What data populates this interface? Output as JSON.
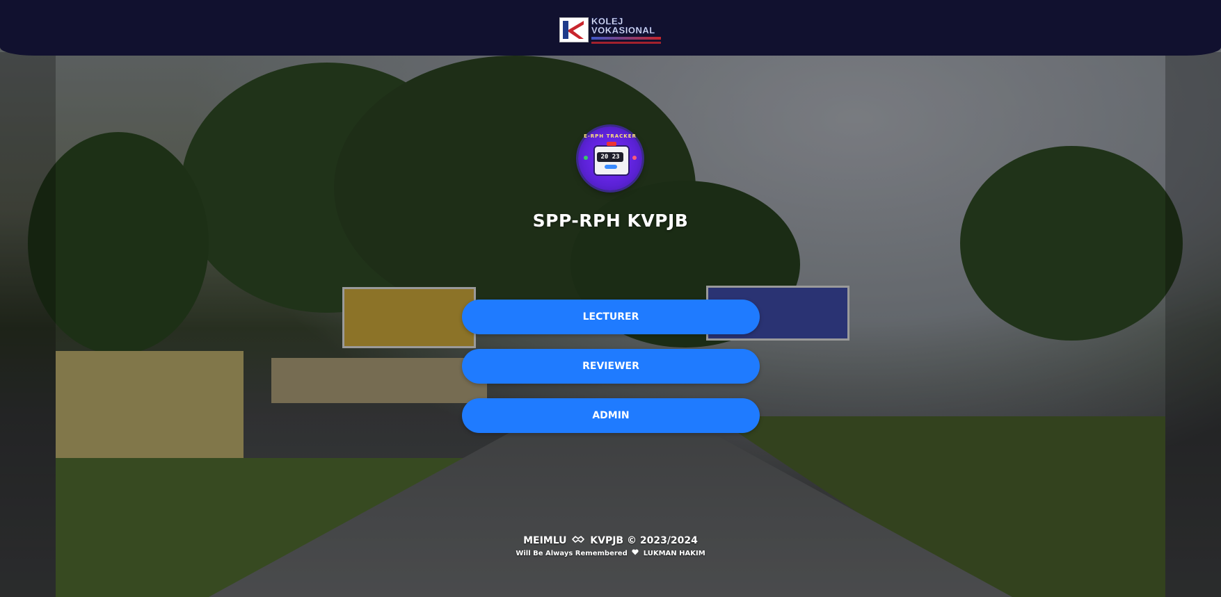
{
  "header": {
    "logo": {
      "icon": "kv-logo-icon",
      "line1": "KOLEJ",
      "line2": "VOKASIONAL"
    }
  },
  "badge": {
    "icon": "rph-tracker-icon",
    "ring_text": "E-RPH TRACKER",
    "value": "20 23"
  },
  "title": "SPP-RPH KVPJB",
  "buttons": {
    "lecturer": "LECTURER",
    "reviewer": "REVIEWER",
    "admin": "ADMIN"
  },
  "footer": {
    "left_text": "MEIMLU",
    "handshake_icon": "handshake-icon",
    "right_text": "KVPJB © 2023/2024",
    "line2_left": "Will Be Always Remembered",
    "heart_icon": "heart-icon",
    "line2_right": "LUKMAN HAKIM"
  },
  "colors": {
    "header_bg": "#11112f",
    "button_bg": "#1f7bff",
    "text": "#ffffff"
  }
}
